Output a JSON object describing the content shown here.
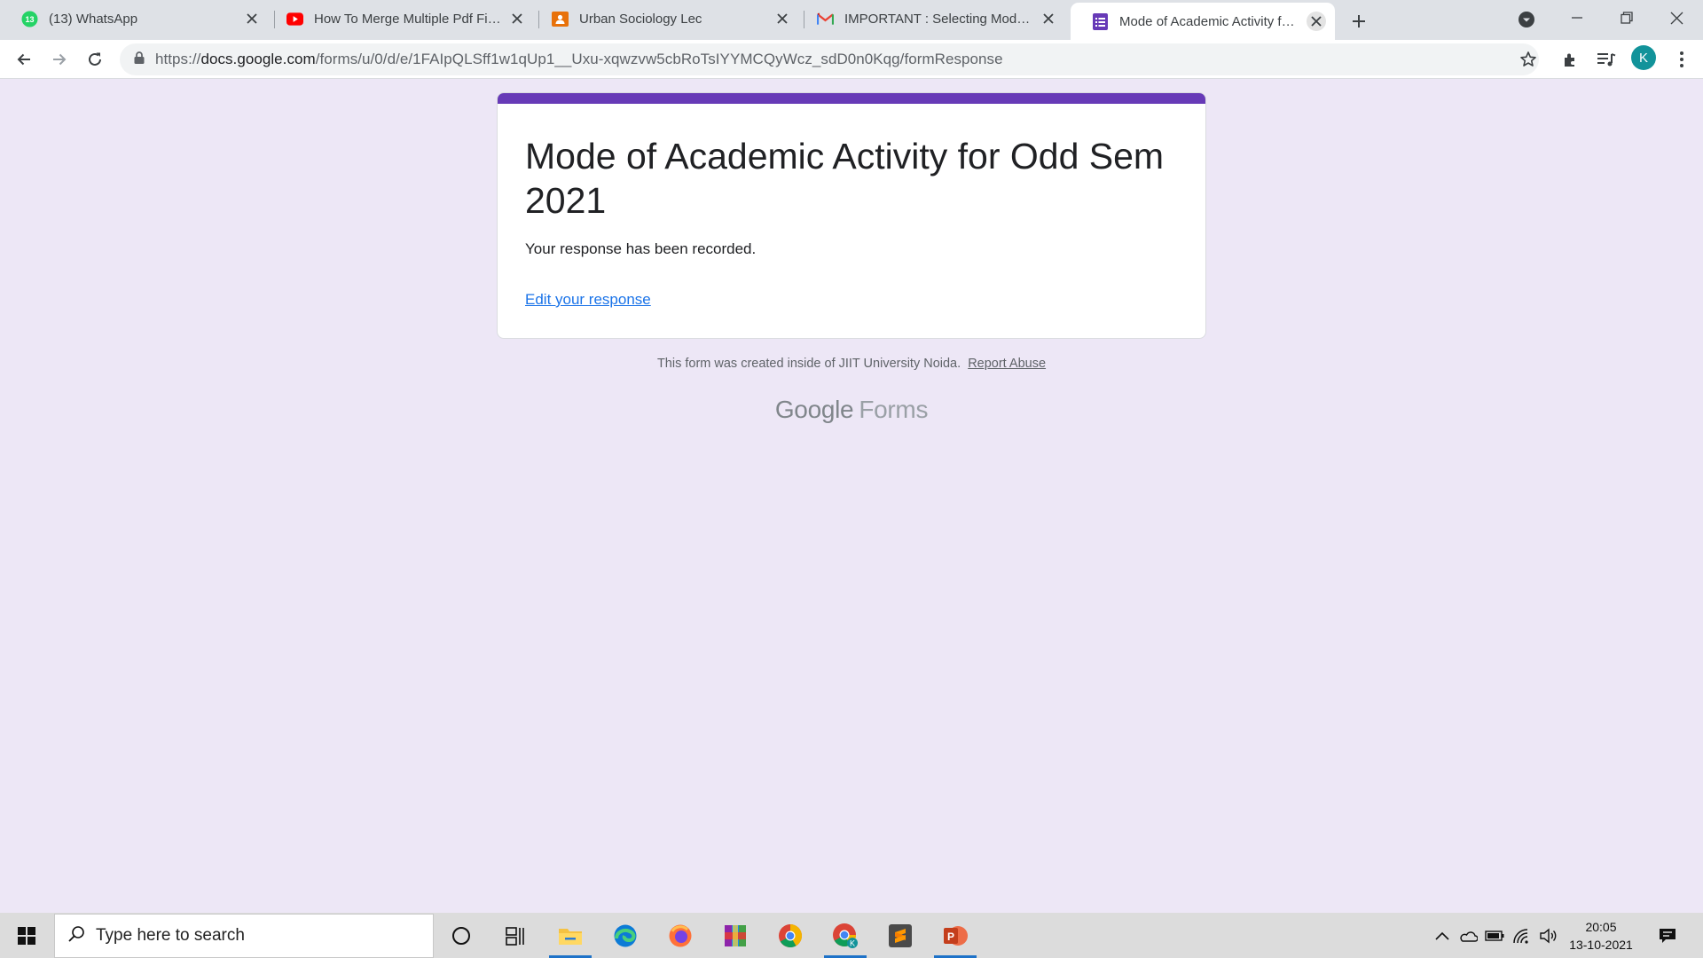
{
  "browser": {
    "tabs": [
      {
        "title": "(13) WhatsApp",
        "icon": "whatsapp-icon",
        "badge": "13",
        "active": false
      },
      {
        "title": "How To Merge Multiple Pdf Files",
        "icon": "youtube-icon",
        "active": false
      },
      {
        "title": "Urban Sociology Lec",
        "icon": "classroom-icon",
        "active": false
      },
      {
        "title": "IMPORTANT : Selecting Mode of",
        "icon": "gmail-icon",
        "active": false
      },
      {
        "title": "Mode of Academic Activity for Odd Sem 2021",
        "icon": "forms-icon",
        "active": true
      }
    ],
    "url_prefix": "https://",
    "url_host": "docs.google.com",
    "url_path": "/forms/u/0/d/e/1FAIpQLSff1w1qUp1__Uxu-xqwzvw5cbRoTsIYYMCQyWcz_sdD0n0Kqg/formResponse",
    "profile_initial": "K",
    "colors": {
      "tabstrip": "#dee1e6",
      "forms_purple": "#673ab7",
      "profile": "#12939a"
    }
  },
  "form": {
    "title": "Mode of Academic Activity for Odd Sem 2021",
    "confirmation": "Your response has been recorded.",
    "edit_link": "Edit your response",
    "footer_text": "This form was created inside of JIIT University Noida.",
    "report_abuse": "Report Abuse",
    "brand_google": "Google",
    "brand_forms": "Forms"
  },
  "taskbar": {
    "search_placeholder": "Type here to search",
    "apps": [
      "cortana-icon",
      "task-view-icon",
      "file-explorer-icon",
      "edge-icon",
      "firefox-icon",
      "winrar-icon",
      "chrome-icon",
      "chrome-profile-icon",
      "sublime-text-icon",
      "powerpoint-icon"
    ],
    "time": "20:05",
    "date": "13-10-2021"
  }
}
